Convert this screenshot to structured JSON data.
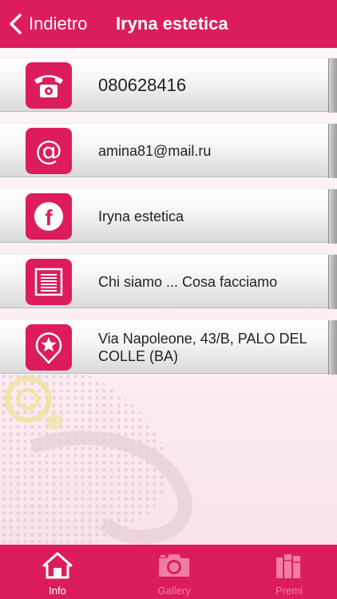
{
  "nav": {
    "back_label": "Indietro",
    "title": "Iryna estetica"
  },
  "rows": [
    {
      "label": "080628416",
      "icon": "telephone-icon"
    },
    {
      "label": "amina81@mail.ru",
      "icon": "at-sign-icon"
    },
    {
      "label": "Iryna estetica",
      "icon": "facebook-icon"
    },
    {
      "label": "Chi siamo ... Cosa facciamo",
      "icon": "document-icon"
    },
    {
      "label": "Via Napoleone, 43/B, PALO DEL COLLE (BA)",
      "icon": "map-pin-star-icon"
    }
  ],
  "tabbar": {
    "items": [
      {
        "label": "Info",
        "icon": "home-icon",
        "active": true
      },
      {
        "label": "Gallery",
        "icon": "camera-icon",
        "active": false
      },
      {
        "label": "Premi",
        "icon": "books-icon",
        "active": false
      }
    ]
  },
  "colors": {
    "accent": "#dd1c5e",
    "inactive_tab": "#ef7ea6",
    "text": "#222222"
  }
}
